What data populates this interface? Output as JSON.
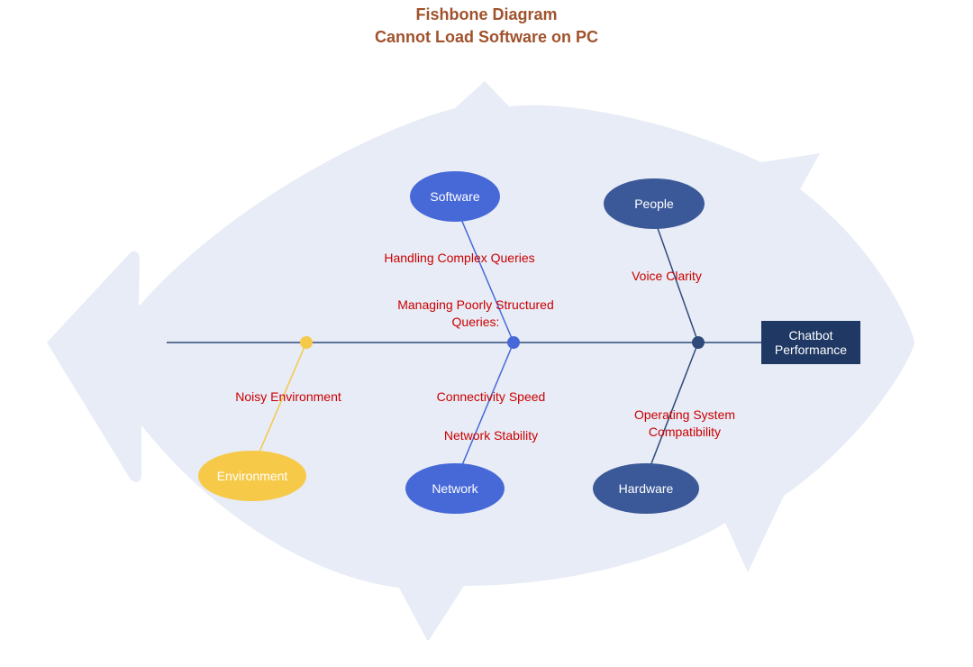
{
  "title": {
    "line1": "Fishbone Diagram",
    "line2": "Cannot Load Software on PC"
  },
  "effect": {
    "label": "Chatbot Performance"
  },
  "categories": {
    "software": {
      "label": "Software",
      "fill": "#4769d8"
    },
    "people": {
      "label": "People",
      "fill": "#3b5998"
    },
    "environment": {
      "label": "Environment",
      "fill": "#f7c948"
    },
    "network": {
      "label": "Network",
      "fill": "#4769d8"
    },
    "hardware": {
      "label": "Hardware",
      "fill": "#3b5998"
    }
  },
  "causes": {
    "software_1": "Handling Complex Queries",
    "software_2": "Managing Poorly Structured\nQueries:",
    "people_1": "Voice Clarity",
    "environment_1": "Noisy Environment",
    "network_1": "Connectivity Speed",
    "network_2": "Network Stability",
    "hardware_1": "Operating System\nCompatibility"
  },
  "colors": {
    "fish_body": "#e7ecf6",
    "spine": "#2f4a7a",
    "bone_yellow": "#f7c948",
    "bone_blue": "#4769d8",
    "bone_dark": "#2f4a7a",
    "dot_yellow": "#f7c948",
    "dot_blue": "#4769d8",
    "dot_dark": "#2f4a7a",
    "cause_text": "#cc0000",
    "title_text": "#a0522d"
  }
}
